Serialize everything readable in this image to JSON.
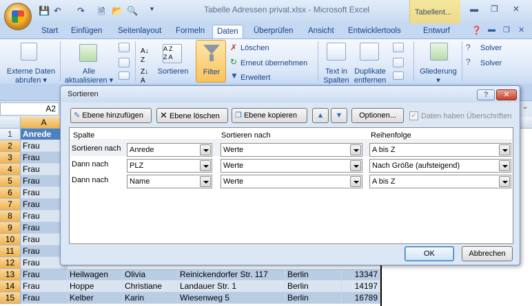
{
  "window": {
    "title": "Tabelle Adressen privat.xlsx - Microsoft Excel",
    "context_tab": "Tabellent..."
  },
  "tabs": [
    "Start",
    "Einfügen",
    "Seitenlayout",
    "Formeln",
    "Daten",
    "Überprüfen",
    "Ansicht",
    "Entwicklertools",
    "Entwurf"
  ],
  "ribbon": {
    "externe": "Externe Daten",
    "abrufen": "abrufen",
    "alle": "Alle",
    "aktualisieren": "aktualisieren",
    "sortieren": "Sortieren",
    "filter": "Filter",
    "loeschen": "Löschen",
    "erneut": "Erneut übernehmen",
    "erweitert": "Erweitert",
    "textin": "Text in",
    "spalten": "Spalten",
    "duplikate": "Duplikate",
    "entfernen": "entfernen",
    "gliederung": "Gliederung",
    "solver1": "Solver",
    "solver2": "Solver"
  },
  "namebox": "A2",
  "grid": {
    "col_a_header": "A",
    "rows": [
      {
        "n": "1",
        "a": "Anrede"
      },
      {
        "n": "2",
        "a": "Frau"
      },
      {
        "n": "3",
        "a": "Frau"
      },
      {
        "n": "4",
        "a": "Frau"
      },
      {
        "n": "5",
        "a": "Frau"
      },
      {
        "n": "6",
        "a": "Frau"
      },
      {
        "n": "7",
        "a": "Frau"
      },
      {
        "n": "8",
        "a": "Frau"
      },
      {
        "n": "9",
        "a": "Frau"
      },
      {
        "n": "10",
        "a": "Frau"
      },
      {
        "n": "11",
        "a": "Frau"
      },
      {
        "n": "12",
        "a": "Frau"
      },
      {
        "n": "13",
        "a": "Frau",
        "b": "Heilwagen",
        "c": "Olivia",
        "d": "Reinickendorfer Str. 117",
        "e": "Berlin",
        "f": "13347"
      },
      {
        "n": "14",
        "a": "Frau",
        "b": "Hoppe",
        "c": "Christiane",
        "d": "Landauer Str. 1",
        "e": "Berlin",
        "f": "14197"
      },
      {
        "n": "15",
        "a": "Frau",
        "b": "Kelber",
        "c": "Karin",
        "d": "Wiesenweg 5",
        "e": "Berlin",
        "f": "16789"
      }
    ]
  },
  "dialog": {
    "title": "Sortieren",
    "help": "?",
    "add_level": "Ebene hinzufügen",
    "delete_level": "Ebene löschen",
    "copy_level": "Ebene kopieren",
    "options": "Optionen...",
    "has_headers": "Daten haben Überschriften",
    "col_header": "Spalte",
    "sort_on_header": "Sortieren nach",
    "order_header": "Reihenfolge",
    "rows": [
      {
        "label": "Sortieren nach",
        "column": "Anrede",
        "sort_on": "Werte",
        "order": "A bis Z"
      },
      {
        "label": "Dann nach",
        "column": "PLZ",
        "sort_on": "Werte",
        "order": "Nach Größe (aufsteigend)"
      },
      {
        "label": "Dann nach",
        "column": "Name",
        "sort_on": "Werte",
        "order": "A bis Z"
      }
    ],
    "ok": "OK",
    "cancel": "Abbrechen"
  }
}
